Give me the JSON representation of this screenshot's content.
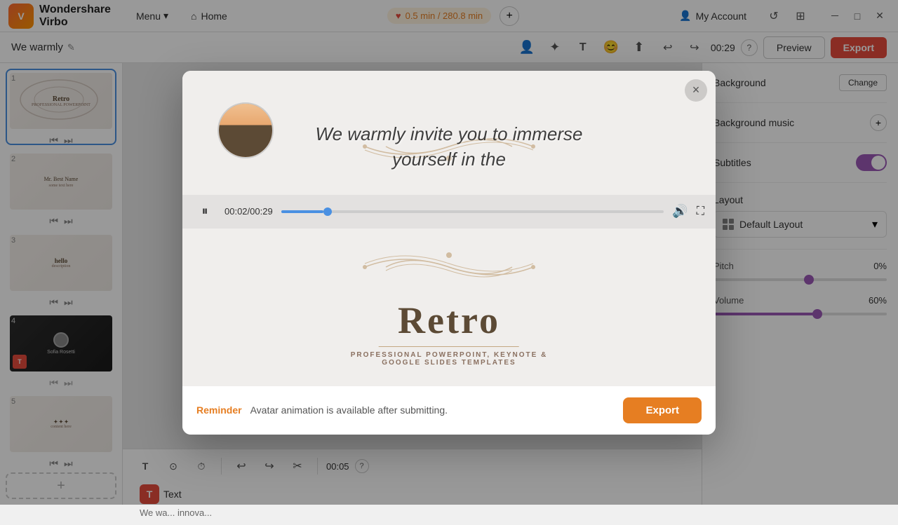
{
  "app": {
    "name": "Virbo",
    "logo_text": "Wondershare\nVirbo"
  },
  "topbar": {
    "menu_label": "Menu",
    "home_label": "Home",
    "duration": "0.5 min / 280.8 min",
    "account_label": "My Account",
    "timer": "00:29",
    "preview_label": "Preview",
    "export_label": "Export"
  },
  "project": {
    "title": "We warmly",
    "edit_icon": "✎"
  },
  "toolbar2": {
    "tools": [
      "👤",
      "✂",
      "T",
      "😊",
      "⬆"
    ]
  },
  "sidebar": {
    "slides": [
      {
        "number": "1",
        "type": "retro",
        "active": true
      },
      {
        "number": "2",
        "type": "retro2"
      },
      {
        "number": "3",
        "type": "retro3"
      },
      {
        "number": "4",
        "type": "dark"
      },
      {
        "number": "5",
        "type": "retro4"
      }
    ],
    "add_label": "+"
  },
  "canvas": {
    "timer": "00:05",
    "text_label": "Text",
    "text_content": "We wa... innova..."
  },
  "right_panel": {
    "background_label": "Background",
    "change_label": "Change",
    "bg_music_label": "Background music",
    "subtitles_label": "Subtitles",
    "layout_label": "Layout",
    "default_layout_label": "Default Layout",
    "pitch_label": "Pitch",
    "pitch_value": "0%",
    "volume_label": "Volume",
    "volume_value": "60%"
  },
  "modal": {
    "close_icon": "×",
    "slide_title": "Retro",
    "slide_subtitle1": "PROFESSIONAL POWERPOINT, KEYNOTE &",
    "slide_subtitle2": "GOOGLE SLIDES TEMPLATES",
    "subtitle_text": "We warmly invite you to immerse\nyourself in the",
    "time_current": "00:02",
    "time_total": "00:29",
    "reminder_label": "Reminder",
    "reminder_text": "Avatar animation is available after submitting.",
    "export_label": "Export"
  }
}
